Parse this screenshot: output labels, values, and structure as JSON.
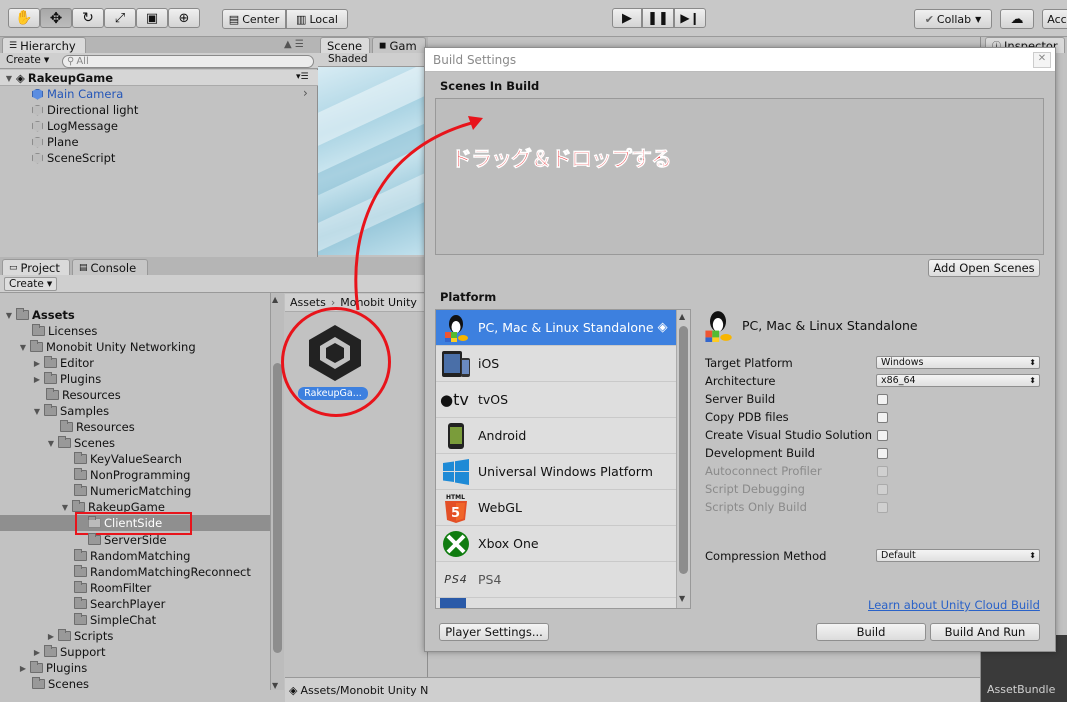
{
  "toolbar": {
    "center": "Center",
    "local": "Local",
    "collab": "Collab",
    "account": "Acc"
  },
  "hierarchy": {
    "tab": "Hierarchy",
    "create": "Create",
    "search_placeholder": "All",
    "scene_name": "RakeupGame",
    "items": [
      "Main Camera",
      "Directional light",
      "LogMessage",
      "Plane",
      "SceneScript"
    ]
  },
  "scene_view": {
    "scene_tab": "Scene",
    "game_tab": "Gam",
    "shaded": "Shaded"
  },
  "project": {
    "tab": "Project",
    "console_tab": "Console",
    "create": "Create",
    "tree": {
      "assets": "Assets",
      "licenses": "Licenses",
      "monobit": "Monobit Unity Networking",
      "editor": "Editor",
      "plugins": "Plugins",
      "resources": "Resources",
      "samples": "Samples",
      "samples_resources": "Resources",
      "scenes": "Scenes",
      "key_value": "KeyValueSearch",
      "non_programming": "NonProgramming",
      "numeric": "NumericMatching",
      "rakeup": "RakeupGame",
      "client": "ClientSide",
      "server": "ServerSide",
      "random": "RandomMatching",
      "random_reconnect": "RandomMatchingReconnect",
      "room_filter": "RoomFilter",
      "search_player": "SearchPlayer",
      "simple_chat": "SimpleChat",
      "scripts": "Scripts",
      "support": "Support",
      "root_plugins": "Plugins",
      "root_scenes": "Scenes"
    },
    "breadcrumb_assets": "Assets",
    "breadcrumb_monobit": "Monobit Unity",
    "asset_label": "RakeupGa...",
    "path": "Assets/Monobit Unity Networking/Samples/Scenes/RakeupGame/ClientSide/RakeupGame.unity"
  },
  "annotation": "ドラッグ＆ドロップする",
  "build": {
    "title": "Build Settings",
    "scenes_in_build": "Scenes In Build",
    "add_open_scenes": "Add Open Scenes",
    "platform_heading": "Platform",
    "platforms": [
      "PC, Mac & Linux Standalone",
      "iOS",
      "tvOS",
      "Android",
      "Universal Windows Platform",
      "WebGL",
      "Xbox One",
      "PS4"
    ],
    "tv_label": "tv",
    "html5_label": "HTML",
    "ps4_logo": "PS4",
    "selected_platform": "PC, Mac & Linux Standalone",
    "target_platform_label": "Target Platform",
    "target_platform_value": "Windows",
    "architecture_label": "Architecture",
    "architecture_value": "x86_64",
    "server_build": "Server Build",
    "copy_pdb": "Copy PDB files",
    "create_vs": "Create Visual Studio Solution",
    "development_build": "Development Build",
    "autoconnect": "Autoconnect Profiler",
    "script_debugging": "Script Debugging",
    "scripts_only": "Scripts Only Build",
    "compression_label": "Compression Method",
    "compression_value": "Default",
    "cloud_link": "Learn about Unity Cloud Build",
    "player_settings": "Player Settings...",
    "build_btn": "Build",
    "build_and_run": "Build And Run"
  },
  "inspector": {
    "tab": "Inspector",
    "asset_bundle": "AssetBundle"
  },
  "colors": {
    "selection_blue": "#3d80df",
    "annotation_red": "#e8141b",
    "link_blue": "#2a62c8"
  }
}
